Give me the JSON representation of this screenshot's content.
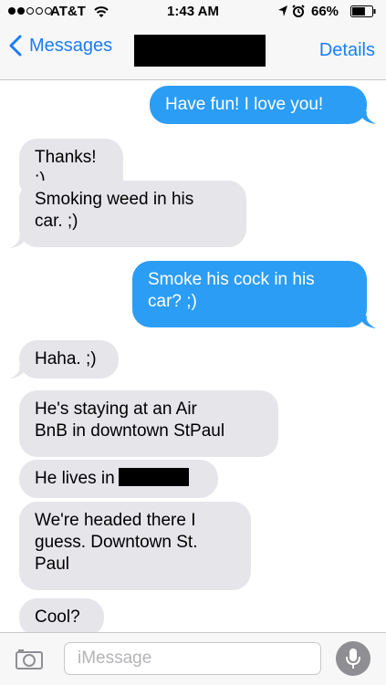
{
  "status": {
    "carrier": "AT&T",
    "time": "1:43 AM",
    "battery": "66%",
    "battery_level": 0.66
  },
  "nav": {
    "back_label": "Messages",
    "details_label": "Details"
  },
  "messages": [
    {
      "from": "me",
      "text": "Have fun! I love you!"
    },
    {
      "from": "them",
      "text": "Thanks! ;)"
    },
    {
      "from": "them",
      "text": "Smoking weed in his\ncar. ;)"
    },
    {
      "from": "me",
      "text": "Smoke his cock in his\ncar? ;)"
    },
    {
      "from": "them",
      "text": "Haha. ;)"
    },
    {
      "from": "them",
      "text": "He's staying at an Air\nBnB in downtown StPaul"
    },
    {
      "from": "them",
      "text": "He lives in"
    },
    {
      "from": "them",
      "text": "We're headed there I\nguess. Downtown St.\nPaul"
    },
    {
      "from": "them",
      "text": "Cool?"
    }
  ],
  "input": {
    "placeholder": "iMessage"
  },
  "icons": {
    "back": "chevron-left-icon",
    "camera": "camera-icon",
    "mic": "microphone-icon",
    "wifi": "wifi-icon",
    "location": "location-arrow-icon",
    "alarm": "alarm-clock-icon",
    "battery": "battery-icon"
  },
  "colors": {
    "accent": "#1b7cf7",
    "outgoing_bubble": "#2b9df5",
    "incoming_bubble": "#e5e5ea"
  }
}
